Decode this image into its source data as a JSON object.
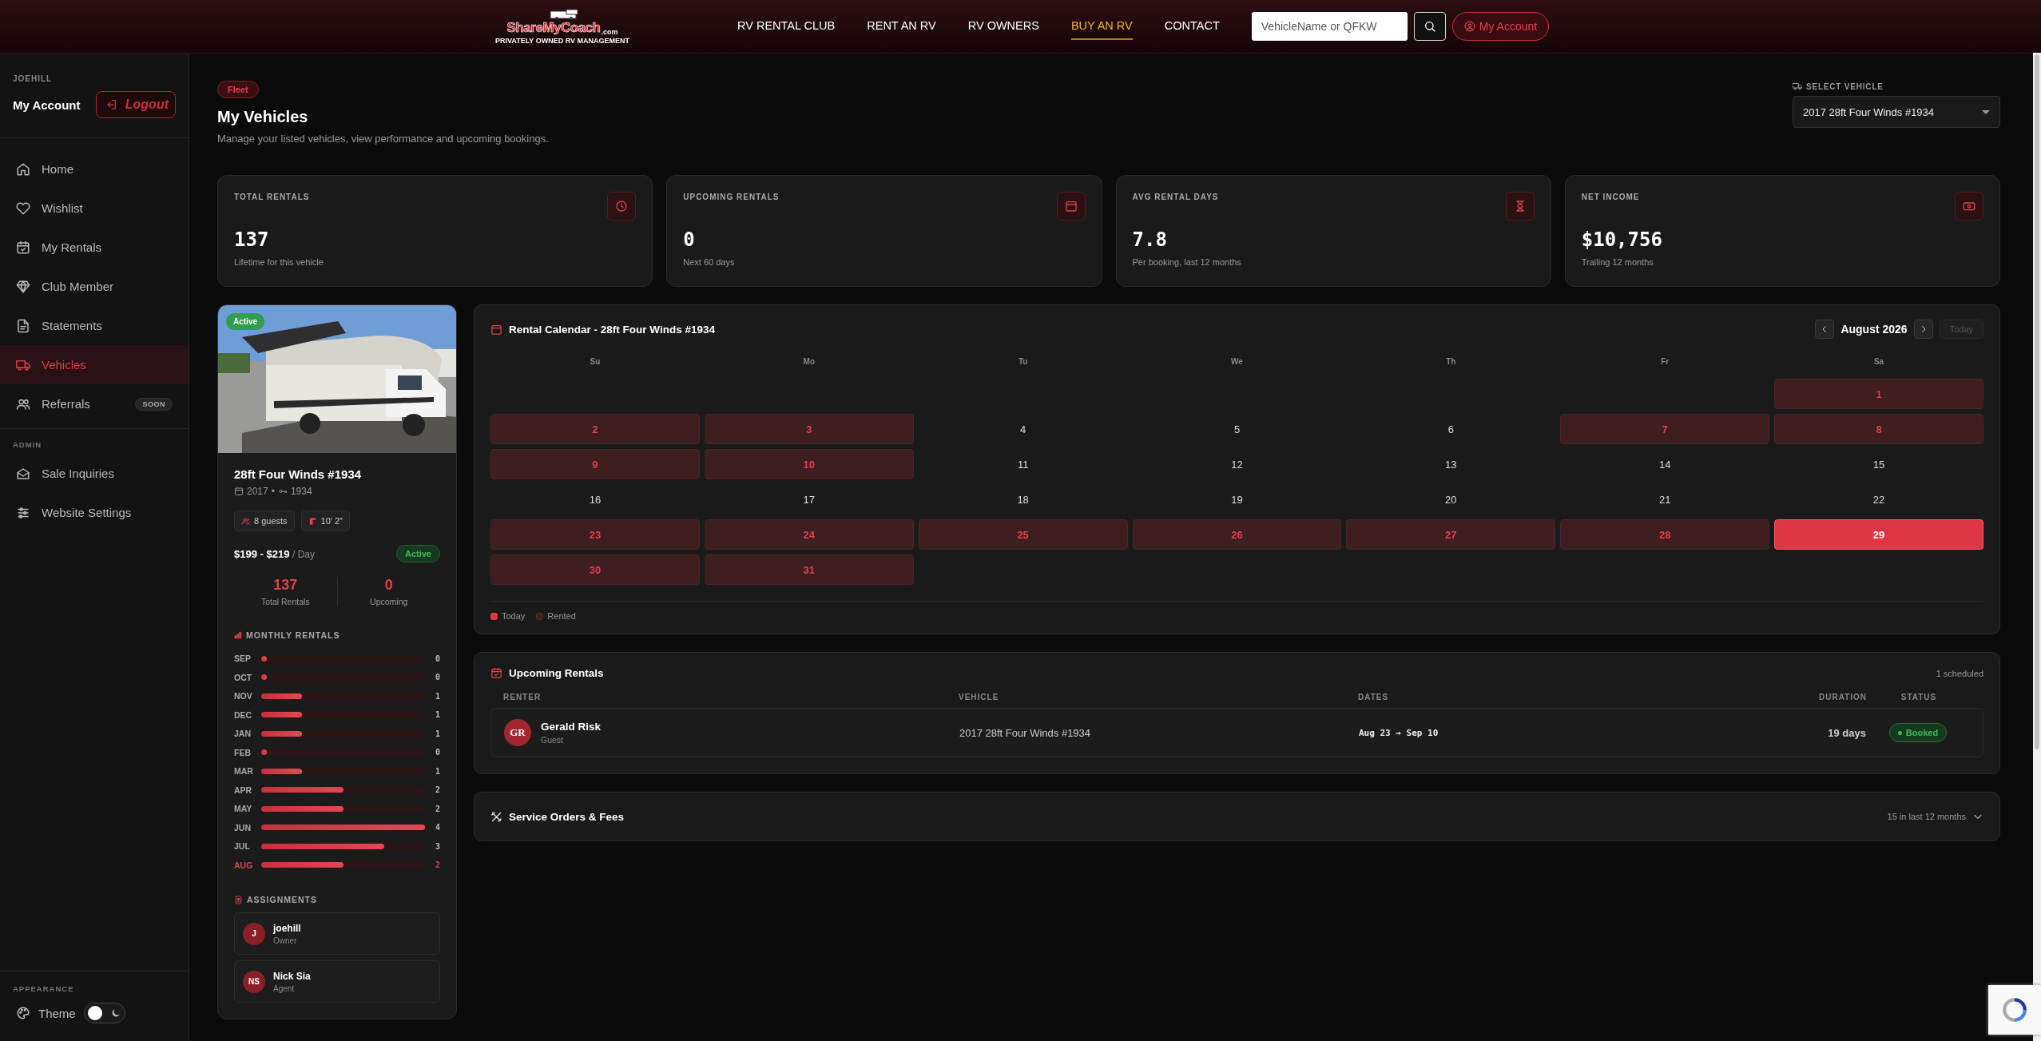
{
  "header": {
    "logo": {
      "name": "ShareMyCoach",
      "suffix": ".com",
      "tagline": "PRIVATELY OWNED RV MANAGEMENT"
    },
    "nav": [
      {
        "label": "RV RENTAL CLUB",
        "selected": false
      },
      {
        "label": "RENT AN RV",
        "selected": false
      },
      {
        "label": "RV OWNERS",
        "selected": false
      },
      {
        "label": "BUY AN RV",
        "selected": true
      },
      {
        "label": "CONTACT",
        "selected": false
      }
    ],
    "search": {
      "placeholder": "VehicleName or QFKW"
    },
    "account_button": "My Account"
  },
  "sidebar": {
    "user": "JOEHILL",
    "account_title": "My Account",
    "logout": "Logout",
    "sections": [
      {
        "items": [
          {
            "label": "Home",
            "selected": false
          },
          {
            "label": "Wishlist",
            "selected": false
          },
          {
            "label": "My Rentals",
            "selected": false
          },
          {
            "label": "Club Member",
            "selected": false
          },
          {
            "label": "Statements",
            "selected": false
          },
          {
            "label": "Vehicles",
            "selected": true
          },
          {
            "label": "Referrals",
            "selected": false,
            "badge": "SOON"
          }
        ]
      },
      {
        "title": "ADMIN",
        "items": [
          {
            "label": "Sale Inquiries",
            "selected": false
          },
          {
            "label": "Website Settings",
            "selected": false
          }
        ]
      }
    ],
    "appearance": {
      "title": "APPEARANCE",
      "label": "Theme",
      "on": false
    }
  },
  "page": {
    "badge": "Fleet",
    "title": "My Vehicles",
    "subtitle": "Manage your listed vehicles, view performance and upcoming bookings.",
    "vehicle_select": {
      "label": "SELECT VEHICLE",
      "value": "2017 28ft Four Winds #1934"
    }
  },
  "stats": [
    {
      "label": "TOTAL RENTALS",
      "value": "137",
      "note": "Lifetime for this vehicle"
    },
    {
      "label": "UPCOMING RENTALS",
      "value": "0",
      "note": "Next 60 days"
    },
    {
      "label": "AVG RENTAL DAYS",
      "value": "7.8",
      "note": "Per booking, last 12 months"
    },
    {
      "label": "NET INCOME",
      "value": "$10,756",
      "note": "Trailing 12 months"
    }
  ],
  "vehicle": {
    "status_badge": "Active",
    "name": "28ft Four Winds #1934",
    "year": "2017",
    "separator": "•",
    "stock": "1934",
    "chips": [
      "8 guests",
      "10' 2\""
    ],
    "price": "$199 - $219",
    "price_unit": "/ Day",
    "status": "Active",
    "counts": [
      {
        "value": "137",
        "label": "Total Rentals"
      },
      {
        "value": "0",
        "label": "Upcoming"
      }
    ],
    "monthly_title": "MONTHLY RENTALS",
    "monthly": [
      {
        "month": "SEP",
        "count": "0",
        "level": 0,
        "current": false
      },
      {
        "month": "OCT",
        "count": "0",
        "level": 0,
        "current": false
      },
      {
        "month": "NOV",
        "count": "1",
        "level": 0.25,
        "current": false
      },
      {
        "month": "DEC",
        "count": "1",
        "level": 0.25,
        "current": false
      },
      {
        "month": "JAN",
        "count": "1",
        "level": 0.25,
        "current": false
      },
      {
        "month": "FEB",
        "count": "0",
        "level": 0,
        "current": false
      },
      {
        "month": "MAR",
        "count": "1",
        "level": 0.25,
        "current": false
      },
      {
        "month": "APR",
        "count": "2",
        "level": 0.5,
        "current": false
      },
      {
        "month": "MAY",
        "count": "2",
        "level": 0.5,
        "current": false
      },
      {
        "month": "JUN",
        "count": "4",
        "level": 1,
        "current": false
      },
      {
        "month": "JUL",
        "count": "3",
        "level": 0.75,
        "current": false
      },
      {
        "month": "AUG",
        "count": "2",
        "level": 0.5,
        "current": true
      }
    ],
    "assignments_title": "ASSIGNMENTS",
    "assignments": [
      {
        "initials": "J",
        "name": "joehill",
        "role": "Owner"
      },
      {
        "initials": "NS",
        "name": "Nick Sia",
        "role": "Agent"
      }
    ]
  },
  "calendar": {
    "title": "Rental Calendar - 28ft Four Winds #1934",
    "month": "August 2026",
    "today_button": {
      "label": "Today",
      "disabled": true
    },
    "weekdays": [
      "Su",
      "Mo",
      "Tu",
      "We",
      "Th",
      "Fr",
      "Sa"
    ],
    "weeks": [
      {
        "kind": "trailing",
        "days": [
          {
            "day": "1",
            "rented": true,
            "today": false
          }
        ]
      },
      {
        "days": [
          {
            "day": "2",
            "rented": true,
            "today": false
          },
          {
            "day": "3",
            "rented": true,
            "today": false
          },
          {
            "day": "4",
            "rented": false,
            "today": false
          },
          {
            "day": "5",
            "rented": false,
            "today": false
          },
          {
            "day": "6",
            "rented": false,
            "today": false
          },
          {
            "day": "7",
            "rented": true,
            "today": false
          },
          {
            "day": "8",
            "rented": true,
            "today": false
          }
        ]
      },
      {
        "days": [
          {
            "day": "9",
            "rented": true,
            "today": false
          },
          {
            "day": "10",
            "rented": true,
            "today": false
          },
          {
            "day": "11",
            "rented": false,
            "today": false
          },
          {
            "day": "12",
            "rented": false,
            "today": false
          },
          {
            "day": "13",
            "rented": false,
            "today": false
          },
          {
            "day": "14",
            "rented": false,
            "today": false
          },
          {
            "day": "15",
            "rented": false,
            "today": false
          }
        ]
      },
      {
        "days": [
          {
            "day": "16",
            "rented": false,
            "today": false
          },
          {
            "day": "17",
            "rented": false,
            "today": false
          },
          {
            "day": "18",
            "rented": false,
            "today": false
          },
          {
            "day": "19",
            "rented": false,
            "today": false
          },
          {
            "day": "20",
            "rented": false,
            "today": false
          },
          {
            "day": "21",
            "rented": false,
            "today": false
          },
          {
            "day": "22",
            "rented": false,
            "today": false
          }
        ]
      },
      {
        "days": [
          {
            "day": "23",
            "rented": true,
            "today": false
          },
          {
            "day": "24",
            "rented": true,
            "today": false
          },
          {
            "day": "25",
            "rented": true,
            "today": false
          },
          {
            "day": "26",
            "rented": true,
            "today": false
          },
          {
            "day": "27",
            "rented": true,
            "today": false
          },
          {
            "day": "28",
            "rented": true,
            "today": false
          },
          {
            "day": "29",
            "rented": true,
            "today": true
          }
        ]
      },
      {
        "days": [
          {
            "day": "30",
            "rented": true,
            "today": false
          },
          {
            "day": "31",
            "rented": true,
            "today": false
          }
        ]
      }
    ],
    "legend": [
      {
        "label": "Today",
        "kind": "today"
      },
      {
        "label": "Rented",
        "kind": "rented"
      }
    ]
  },
  "upcoming": {
    "title": "Upcoming Rentals",
    "count": "1 scheduled",
    "columns": [
      "RENTER",
      "VEHICLE",
      "DATES",
      "DURATION",
      "STATUS"
    ],
    "rows": [
      {
        "initials": "GR",
        "name": "Gerald Risk",
        "role": "Guest",
        "vehicle": "2017 28ft Four Winds #1934",
        "dates": "Aug 23 → Sep 10",
        "duration": "19 days",
        "status": "Booked"
      }
    ]
  },
  "service": {
    "title": "Service Orders & Fees",
    "summary": "15 in last 12 months",
    "expanded": false
  }
}
